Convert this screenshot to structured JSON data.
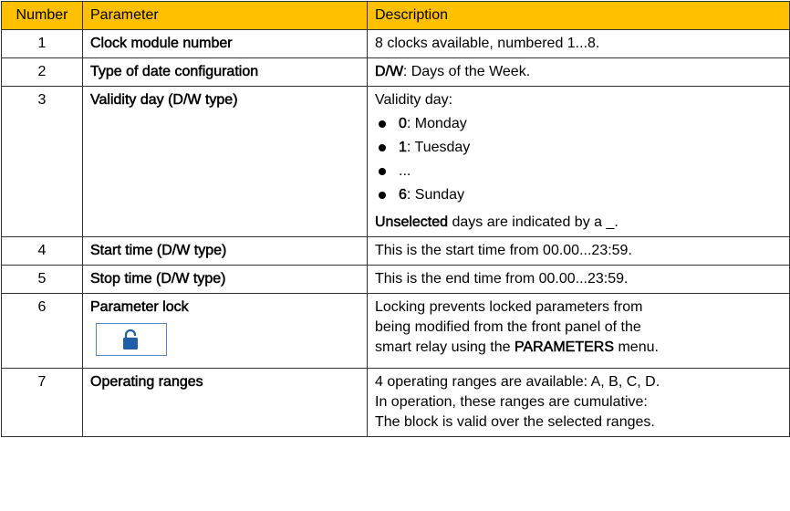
{
  "headers": {
    "number": "Number",
    "parameter": "Parameter",
    "description": "Description"
  },
  "rows": [
    {
      "number": "1",
      "parameter": "Clock module number",
      "description": "8 clocks available, numbered 1...8."
    },
    {
      "number": "2",
      "parameter": "Type of date configuration",
      "desc_bold": "D/W",
      "desc_rest": ": Days of the Week."
    },
    {
      "number": "3",
      "parameter": "Validity day (D/W type)",
      "desc_intro": "Validity day:",
      "days": [
        {
          "key": "0",
          "label": ": Monday"
        },
        {
          "key": "1",
          "label": ": Tuesday"
        },
        {
          "key": "",
          "label": "..."
        },
        {
          "key": "6",
          "label": ": Sunday"
        }
      ],
      "note_bold": "Unselected",
      "note_rest": " days are indicated by a _."
    },
    {
      "number": "4",
      "parameter": "Start time (D/W type)",
      "description": "This is the start time from 00.00...23:59."
    },
    {
      "number": "5",
      "parameter": "Stop time (D/W type)",
      "description": "This is the end time from 00.00...23:59."
    },
    {
      "number": "6",
      "parameter": "Parameter lock",
      "lock_icon": "padlock-icon",
      "desc_line1": "Locking prevents locked parameters from",
      "desc_line2": "being modified from the front panel of the",
      "desc_line3_pre": "smart relay using the ",
      "desc_line3_bold": "PARAMETERS",
      "desc_line3_post": " menu."
    },
    {
      "number": "7",
      "parameter": "Operating ranges",
      "desc_line1": "4 operating ranges are available: A, B, C, D.",
      "desc_line2": "In operation, these ranges are cumulative:",
      "desc_line3": "The block is valid over the selected ranges."
    }
  ],
  "colors": {
    "header_bg": "#ffc000",
    "lock_blue": "#1f5fa8",
    "lock_border": "#5a86c9"
  }
}
